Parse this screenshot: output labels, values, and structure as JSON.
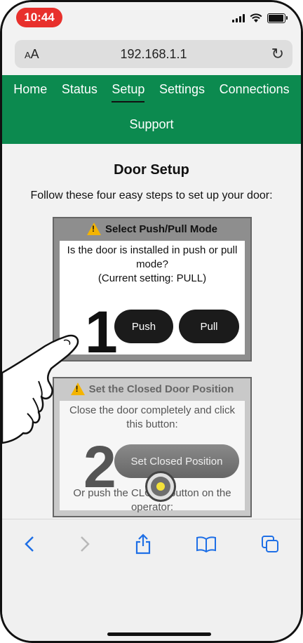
{
  "statusbar": {
    "time": "10:44",
    "time_color": "#e8302c",
    "battery_level": 0.95
  },
  "browser": {
    "text_size_label": "AA",
    "url": "192.168.1.1",
    "reload_icon": "reload-icon"
  },
  "nav": {
    "color": "#0c8a4f",
    "items": [
      {
        "label": "Home"
      },
      {
        "label": "Status"
      },
      {
        "label": "Setup",
        "active": true
      },
      {
        "label": "Settings"
      },
      {
        "label": "Connections"
      },
      {
        "label": "Support"
      }
    ]
  },
  "page": {
    "title": "Door Setup",
    "subtitle": "Follow these four easy steps to set up your door:"
  },
  "steps": [
    {
      "number": "1",
      "title": "Select Push/Pull Mode",
      "text": "Is the door is installed in push or pull mode?",
      "current": "(Current setting: PULL)",
      "buttons": [
        "Push",
        "Pull"
      ]
    },
    {
      "number": "2",
      "title": "Set the Closed Door Position",
      "text": "Close the door completely and click this button:",
      "button": "Set Closed Position",
      "alt_text": "Or push the CLOSE button on the operator:"
    }
  ],
  "toolbar": {
    "icons": [
      "back-icon",
      "forward-icon",
      "share-icon",
      "bookmarks-icon",
      "tabs-icon"
    ]
  }
}
